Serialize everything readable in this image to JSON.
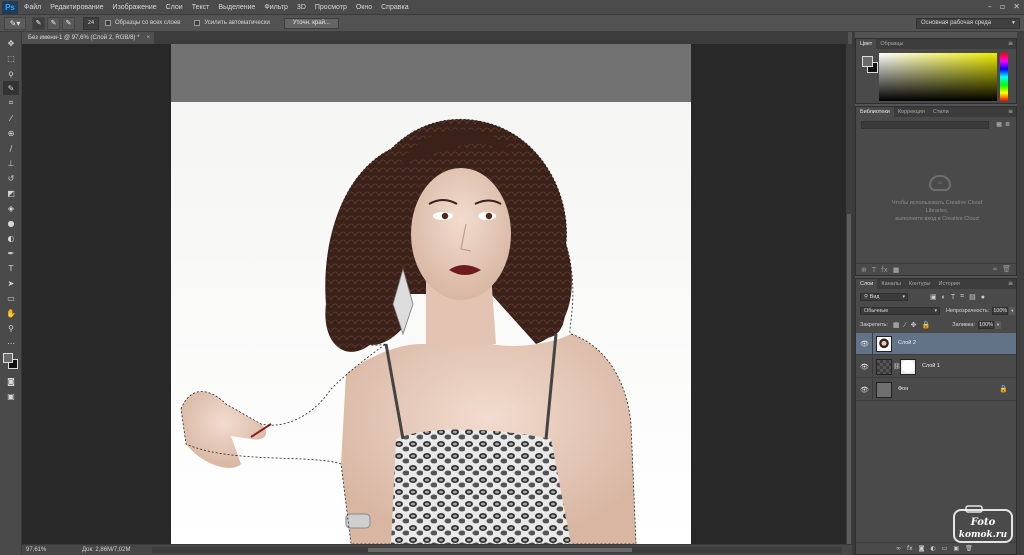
{
  "app": {
    "logo": "Ps",
    "menu": [
      "Файл",
      "Редактирование",
      "Изображение",
      "Слои",
      "Текст",
      "Выделение",
      "Фильтр",
      "3D",
      "Просмотр",
      "Окно",
      "Справка"
    ],
    "window_controls": [
      "minimize-icon",
      "maximize-icon",
      "close-icon"
    ]
  },
  "options_bar": {
    "tool_icon": "quick-selection-brush-icon",
    "brush_size": "24",
    "sample_all_layers": "Образцы со всех слоев",
    "auto_enhance": "Усилить автоматически",
    "refine_edge": "Уточн. край...",
    "workspace": "Основная рабочая среда"
  },
  "document": {
    "tab_title": "Без имени-1 @ 97,6% (Слой 2, RGB/8) *",
    "close_glyph": "×"
  },
  "status": {
    "zoom": "97,61%",
    "doc_size": "Док: 2,86M/7,02M"
  },
  "color_panel": {
    "tabs": [
      "Цвет",
      "Образцы"
    ],
    "foreground": "#6b6b6b",
    "background": "#111111"
  },
  "library_panel": {
    "tabs": [
      "Библиотеки",
      "Коррекция",
      "Стили"
    ],
    "message_line1": "Чтобы использовать Creative Cloud",
    "message_line2": "Libraries,",
    "message_line3": "выполните вход в Creative Cloud"
  },
  "layers_panel": {
    "tabs": [
      "Слои",
      "Каналы",
      "Контуры",
      "История"
    ],
    "filter_kind": "Вид",
    "blend_mode": "Обычные",
    "opacity_label": "Непрозрачность:",
    "opacity_value": "100%",
    "lock_label": "Закрепить:",
    "fill_label": "Заливка:",
    "fill_value": "100%",
    "layers": [
      {
        "name": "Слой 2",
        "selected": true
      },
      {
        "name": "Слой 1",
        "selected": false
      },
      {
        "name": "Фон",
        "selected": false
      }
    ]
  },
  "watermark": {
    "line1": "Foto",
    "line2": "komok.ru"
  }
}
